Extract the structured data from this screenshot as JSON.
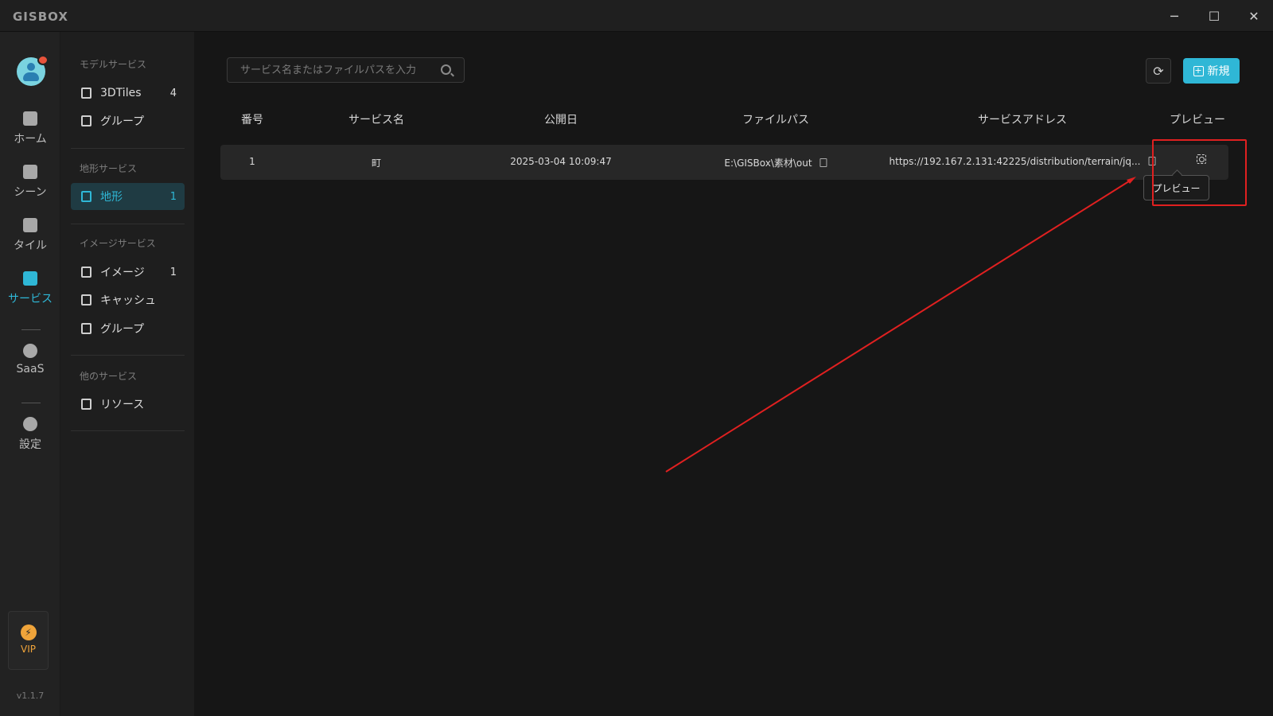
{
  "app": {
    "logo": "GISBOX",
    "version": "v1.1.7"
  },
  "window": {
    "minimize": "─",
    "maximize": "☐",
    "close": "✕"
  },
  "rail": {
    "items": [
      {
        "label": "ホーム",
        "icon": "home-icon"
      },
      {
        "label": "シーン",
        "icon": "scene-icon"
      },
      {
        "label": "タイル",
        "icon": "tile-icon"
      },
      {
        "label": "サービス",
        "icon": "service-icon",
        "active": true
      },
      {
        "label": "SaaS",
        "icon": "saas-icon"
      },
      {
        "label": "設定",
        "icon": "settings-icon"
      }
    ],
    "vip": "VIP"
  },
  "sidebar": {
    "groups": [
      {
        "title": "モデルサービス",
        "items": [
          {
            "label": "3DTiles",
            "count": "4"
          },
          {
            "label": "グループ",
            "count": ""
          }
        ]
      },
      {
        "title": "地形サービス",
        "items": [
          {
            "label": "地形",
            "count": "1",
            "active": true
          }
        ]
      },
      {
        "title": "イメージサービス",
        "items": [
          {
            "label": "イメージ",
            "count": "1"
          },
          {
            "label": "キャッシュ",
            "count": ""
          },
          {
            "label": "グループ",
            "count": ""
          }
        ]
      },
      {
        "title": "他のサービス",
        "items": [
          {
            "label": "リソース",
            "count": ""
          }
        ]
      }
    ]
  },
  "toolbar": {
    "search_placeholder": "サービス名またはファイルパスを入力",
    "new_label": "新規"
  },
  "table": {
    "headers": [
      "番号",
      "サービス名",
      "公開日",
      "ファイルパス",
      "サービスアドレス",
      "プレビュー"
    ],
    "rows": [
      {
        "no": "1",
        "name": "町",
        "date": "2025-03-04 10:09:47",
        "path": "E:\\GISBox\\素材\\out",
        "address": "https://192.167.2.131:42225/distribution/terrain/jq..."
      }
    ]
  },
  "tooltip": "プレビュー",
  "colors": {
    "accent": "#2fb7d6",
    "annotation": "#e02020",
    "vip": "#f0a43a"
  }
}
